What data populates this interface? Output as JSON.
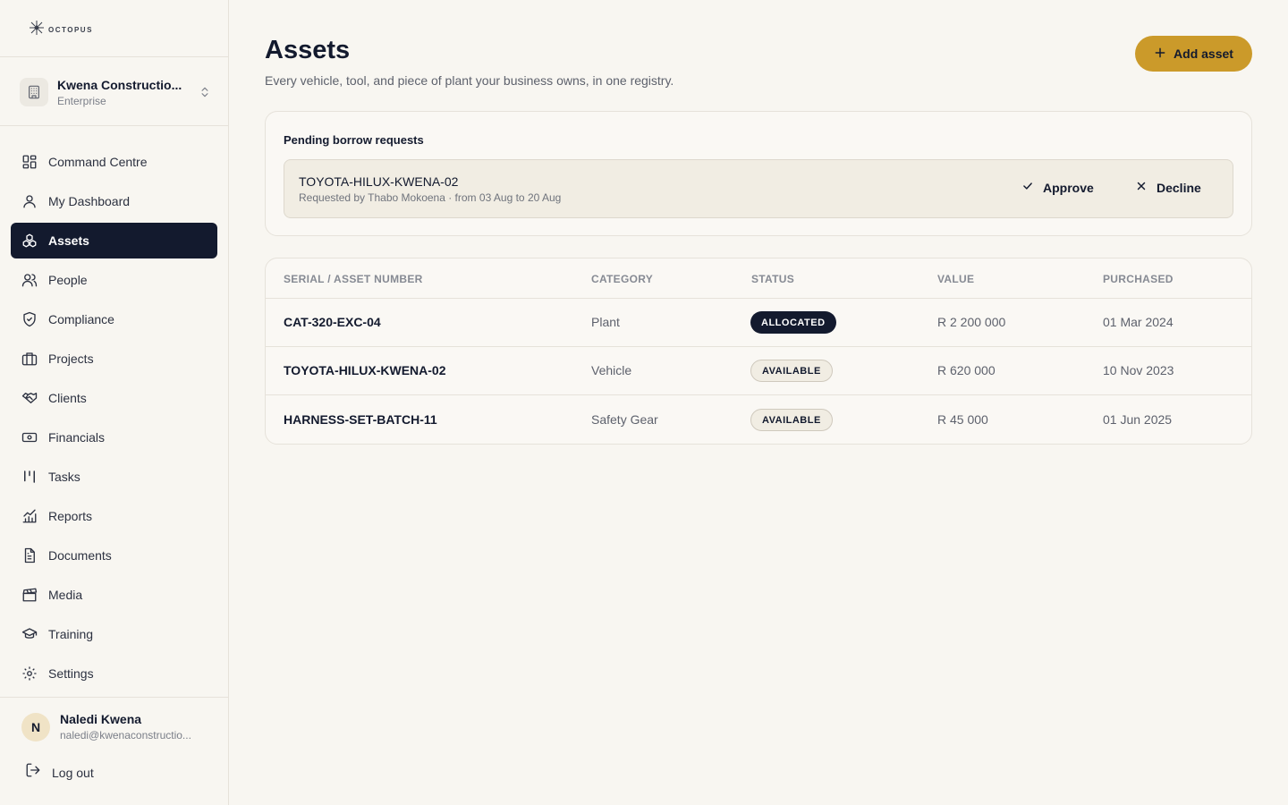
{
  "app": {
    "logo_text": "OCTOPUS"
  },
  "org": {
    "name": "Kwena Constructio...",
    "plan": "Enterprise"
  },
  "nav": [
    {
      "label": "Command Centre",
      "icon": "grid-icon",
      "active": false
    },
    {
      "label": "My Dashboard",
      "icon": "user-icon",
      "active": false
    },
    {
      "label": "Assets",
      "icon": "boxes-icon",
      "active": true
    },
    {
      "label": "People",
      "icon": "users-icon",
      "active": false
    },
    {
      "label": "Compliance",
      "icon": "shield-check-icon",
      "active": false
    },
    {
      "label": "Projects",
      "icon": "briefcase-icon",
      "active": false
    },
    {
      "label": "Clients",
      "icon": "handshake-icon",
      "active": false
    },
    {
      "label": "Financials",
      "icon": "banknote-icon",
      "active": false
    },
    {
      "label": "Tasks",
      "icon": "kanban-icon",
      "active": false
    },
    {
      "label": "Reports",
      "icon": "chart-icon",
      "active": false
    },
    {
      "label": "Documents",
      "icon": "document-icon",
      "active": false
    },
    {
      "label": "Media",
      "icon": "clapperboard-icon",
      "active": false
    },
    {
      "label": "Training",
      "icon": "graduation-cap-icon",
      "active": false
    },
    {
      "label": "Settings",
      "icon": "gear-icon",
      "active": false
    }
  ],
  "user": {
    "initial": "N",
    "name": "Naledi Kwena",
    "email": "naledi@kwenaconstructio..."
  },
  "logout_label": "Log out",
  "page": {
    "title": "Assets",
    "subtitle": "Every vehicle, tool, and piece of plant your business owns, in one registry.",
    "add_button": "Add asset"
  },
  "pending": {
    "title": "Pending borrow requests",
    "requests": [
      {
        "asset": "TOYOTA-HILUX-KWENA-02",
        "meta": "Requested by Thabo Mokoena · from 03 Aug to 20 Aug",
        "approve_label": "Approve",
        "decline_label": "Decline"
      }
    ]
  },
  "table": {
    "columns": [
      "SERIAL / ASSET NUMBER",
      "CATEGORY",
      "STATUS",
      "VALUE",
      "PURCHASED"
    ],
    "rows": [
      {
        "serial": "CAT-320-EXC-04",
        "category": "Plant",
        "status": "ALLOCATED",
        "value": "R 2 200 000",
        "purchased": "01 Mar 2024"
      },
      {
        "serial": "TOYOTA-HILUX-KWENA-02",
        "category": "Vehicle",
        "status": "AVAILABLE",
        "value": "R 620 000",
        "purchased": "10 Nov 2023"
      },
      {
        "serial": "HARNESS-SET-BATCH-11",
        "category": "Safety Gear",
        "status": "AVAILABLE",
        "value": "R 45 000",
        "purchased": "01 Jun 2025"
      }
    ]
  },
  "colors": {
    "accent": "#cb9a2a",
    "navy": "#131a2e",
    "background": "#f8f6f1"
  }
}
